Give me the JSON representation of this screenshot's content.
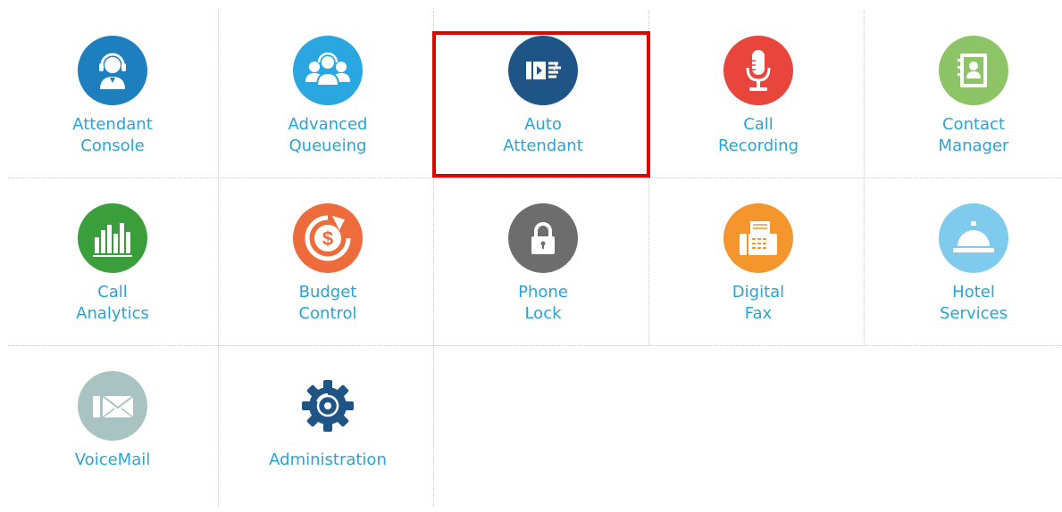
{
  "tiles": [
    {
      "id": "attendant-console",
      "lines": [
        "Attendant",
        "Console"
      ],
      "icon": "headset-agent-icon",
      "color": "#1d7fbd"
    },
    {
      "id": "advanced-queueing",
      "lines": [
        "Advanced",
        "Queueing"
      ],
      "icon": "agent-group-icon",
      "color": "#2aa7e0"
    },
    {
      "id": "auto-attendant",
      "lines": [
        "Auto",
        "Attendant"
      ],
      "icon": "ivr-menu-icon",
      "color": "#1f5586"
    },
    {
      "id": "call-recording",
      "lines": [
        "Call",
        "Recording"
      ],
      "icon": "microphone-icon",
      "color": "#e8453c"
    },
    {
      "id": "contact-manager",
      "lines": [
        "Contact",
        "Manager"
      ],
      "icon": "address-book-icon",
      "color": "#8dc465"
    },
    {
      "id": "call-analytics",
      "lines": [
        "Call",
        "Analytics"
      ],
      "icon": "bar-chart-icon",
      "color": "#3a9e3a"
    },
    {
      "id": "budget-control",
      "lines": [
        "Budget",
        "Control"
      ],
      "icon": "dollar-target-icon",
      "color": "#ee6c3b"
    },
    {
      "id": "phone-lock",
      "lines": [
        "Phone",
        "Lock"
      ],
      "icon": "padlock-icon",
      "color": "#6d6d6d"
    },
    {
      "id": "digital-fax",
      "lines": [
        "Digital",
        "Fax"
      ],
      "icon": "fax-machine-icon",
      "color": "#f4962c"
    },
    {
      "id": "hotel-services",
      "lines": [
        "Hotel",
        "Services"
      ],
      "icon": "service-bell-icon",
      "color": "#7ecbee"
    },
    {
      "id": "voicemail",
      "lines": [
        "VoiceMail"
      ],
      "icon": "envelope-icon",
      "color": "#a9c3c3"
    },
    {
      "id": "administration",
      "lines": [
        "Administration"
      ],
      "icon": "gear-icon",
      "color": "#1f5586"
    }
  ],
  "selected_tile": "auto-attendant",
  "label_color": "#29a3d6",
  "highlight_color": "#e00000"
}
